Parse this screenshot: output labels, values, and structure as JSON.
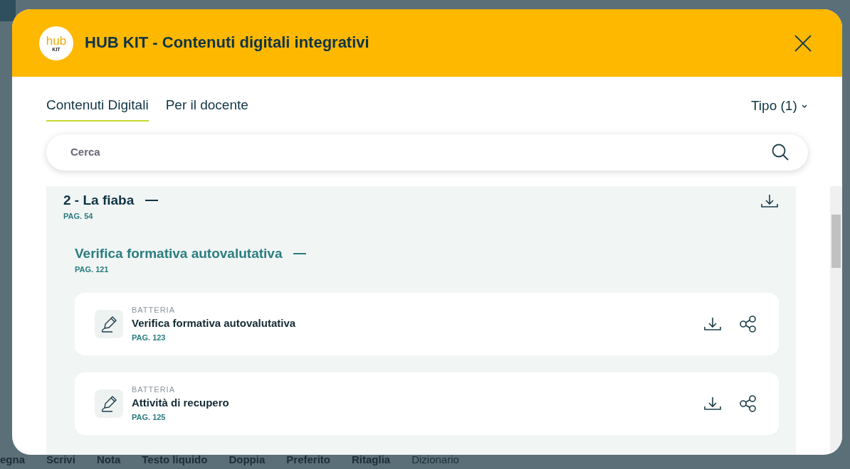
{
  "toolbar": [
    {
      "label": "egna",
      "disabled": false
    },
    {
      "label": "Scrivi",
      "disabled": false
    },
    {
      "label": "Nota",
      "disabled": false
    },
    {
      "label": "Testo liquido",
      "disabled": false
    },
    {
      "label": "Doppia",
      "disabled": false
    },
    {
      "label": "Preferito",
      "disabled": false
    },
    {
      "label": "Ritaglia",
      "disabled": false
    },
    {
      "label": "Dizionario",
      "disabled": true
    }
  ],
  "dialog": {
    "logo": {
      "text": "hub",
      "subtext": "KIT"
    },
    "title": "HUB KIT - Contenuti digitali integrativi",
    "tabs": [
      {
        "label": "Contenuti Digitali",
        "selected": true
      },
      {
        "label": "Per il docente",
        "selected": false
      }
    ],
    "filter": "Tipo (1)",
    "search": {
      "placeholder": "Cerca"
    },
    "sections": [
      {
        "title": "2 - La fiaba",
        "page": "PAG. 54",
        "expanded": true,
        "subsections": [
          {
            "title": "Verifica formativa autovalutativa",
            "page": "PAG. 121",
            "expanded": true,
            "items": [
              {
                "category": "BATTERIA",
                "title": "Verifica formativa autovalutativa",
                "page": "PAG. 123"
              },
              {
                "category": "BATTERIA",
                "title": "Attività di recupero",
                "page": "PAG. 125"
              }
            ]
          }
        ]
      }
    ]
  }
}
